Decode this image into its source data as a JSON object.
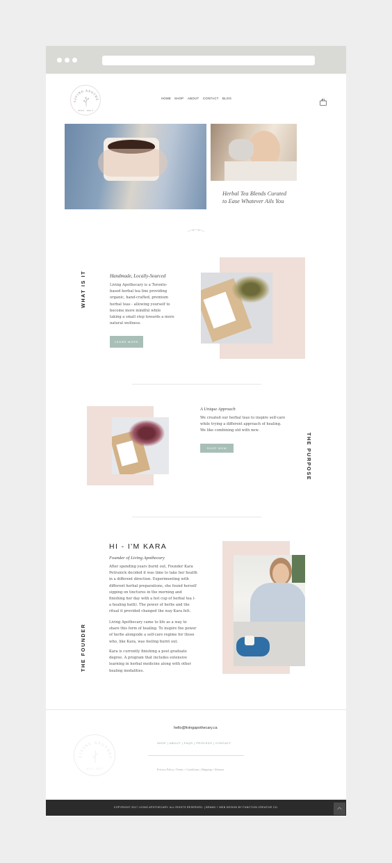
{
  "nav": {
    "items": [
      "HOME",
      "SHOP",
      "ABOUT",
      "CONTACT",
      "BLOG"
    ],
    "cart_count": "0"
  },
  "logo": {
    "name": "LIVING APOTHECARY",
    "est": "EST. 2017"
  },
  "hero": {
    "tagline_line1": "Herbal Tea Blends Curated",
    "tagline_line2": "to Ease Whatever Ails You"
  },
  "what_is_it": {
    "label": "WHAT IS IT",
    "heading": "Handmade, Locally-Sourced",
    "lines": [
      "Living Apothecary is a Toronto-",
      "based herbal tea line providing",
      "organic, hand-crafted, premium",
      "herbal teas - allowing yourself to",
      "become more mindful while",
      "taking a small step towards a more",
      "natural wellness."
    ],
    "button": "LEARN MORE"
  },
  "purpose": {
    "label": "THE PURPOSE",
    "heading": "A Unique Approach",
    "lines": [
      "We created our herbal teas to inspire self-care",
      "while trying a different approach of healing.",
      "We like combining old with new."
    ],
    "button": "SHOP NOW"
  },
  "founder": {
    "label": "THE FOUNDER",
    "title": "HI - I'M KARA",
    "subtitle": "Founder of Living Apothecary",
    "p1": [
      "After spending years burnt out, Founder Kara",
      "Petrunick decided it was time to take her health",
      "in a different direction. Experimenting with",
      "different herbal preparations, she found herself",
      "sipping on tinctures in the morning and",
      "finishing her day with a hot cup of herbal tea (-",
      "a healing bath). The power of herbs and the",
      "ritual it provided changed the way Kara felt."
    ],
    "p2": [
      "Living Apothecary came to life as a way to",
      "share this form of healing. To inspire the power",
      "of herbs alongside a self-care regime for those",
      "who, like Kara, was feeling burnt out."
    ],
    "p3": [
      "Kara is currently finishing a post graduate",
      "degree. A program that includes extensive",
      "learning in herbal medicine along with other",
      "healing modalities."
    ]
  },
  "footer": {
    "email": "hello@livingapothecary.ca",
    "links": "SHOP | ABOUT | FAQS | PROCESS | CONTACT",
    "legal": "Privacy Policy | Terms + Conditions | Shipping + Returns",
    "copyright": "COPYRIGHT 2017 LIVING APOTHECARY. ALL RIGHTS RESERVED. | BRAND + WEB DESIGN BY FUNCTION CREATIVE CO."
  },
  "colors": {
    "accent_green": "#a8bfb7",
    "accent_pink": "#efdfd8",
    "dark": "#2b2b2b"
  }
}
